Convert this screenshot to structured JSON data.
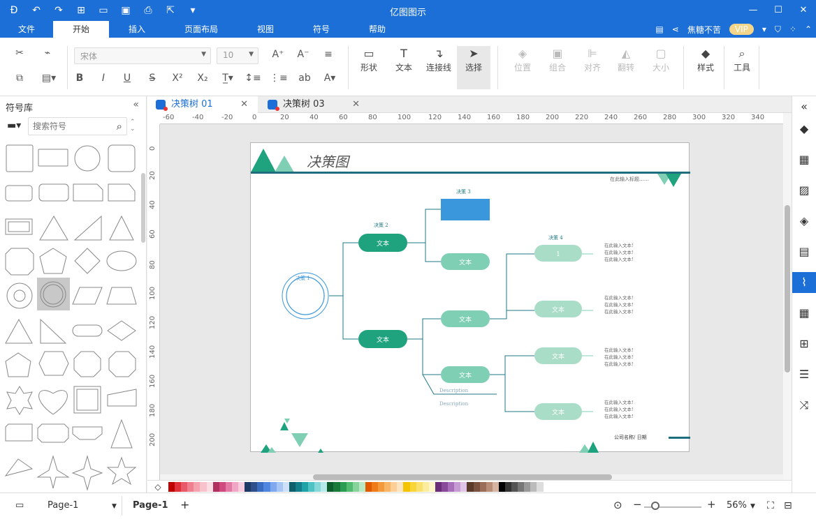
{
  "app": {
    "title": "亿图图示"
  },
  "colors": {
    "brand": "#1c6fd6",
    "teal_dark": "#1fa37e",
    "teal_light": "#7fcfb4",
    "teal_pale": "#a9ddc8",
    "blue_box": "#3b97dc"
  },
  "quick_access": [
    "logo-icon",
    "undo-icon",
    "redo-icon",
    "new-icon",
    "open-icon",
    "save-icon",
    "print-icon",
    "export-icon",
    "more-icon"
  ],
  "menu": {
    "tabs": [
      "文件",
      "开始",
      "插入",
      "页面布局",
      "视图",
      "符号",
      "帮助"
    ],
    "active": "开始",
    "user": "焦糖不苦",
    "vip": "VIP"
  },
  "ribbon": {
    "font_name": "宋体",
    "font_size": "10",
    "shape": "形状",
    "text": "文本",
    "connector": "连接线",
    "select": "选择",
    "position": "位置",
    "group": "组合",
    "align": "对齐",
    "flip": "翻转",
    "size": "大小",
    "style": "样式",
    "tools": "工具"
  },
  "library": {
    "title": "符号库",
    "search_placeholder": "搜索符号"
  },
  "doc_tabs": [
    {
      "label": "决策树 01",
      "active": true
    },
    {
      "label": "决策树 03",
      "active": false
    }
  ],
  "ruler": {
    "top": [
      "-60",
      "-40",
      "-20",
      "0",
      "20",
      "40",
      "60",
      "80",
      "100",
      "120",
      "140",
      "160",
      "180",
      "200",
      "220",
      "240",
      "260",
      "280",
      "300",
      "320",
      "340"
    ],
    "left": [
      "0",
      "20",
      "40",
      "60",
      "80",
      "100",
      "120",
      "140",
      "160",
      "180",
      "200"
    ]
  },
  "diagram": {
    "title": "决策图",
    "subtitle": "在此输入标题……",
    "decision1": "决策 1",
    "decision2": "决策 2",
    "decision3": "决策 3",
    "decision4": "决策 4",
    "node_text": "文本",
    "node_one": "1",
    "note": "在此输入文本!",
    "description": "Description",
    "footer": "公司名称/ 日期"
  },
  "status": {
    "page_select": "Page-1",
    "page_tab": "Page-1",
    "zoom": "56%"
  }
}
